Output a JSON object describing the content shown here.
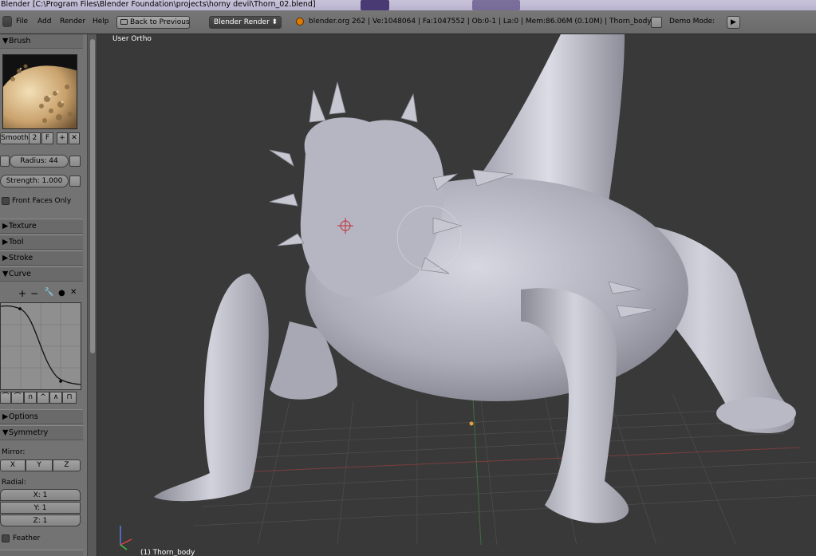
{
  "window": {
    "title": "Blender [C:\\Program Files\\Blender Foundation\\projects\\horny devil\\Thorn_02.blend]"
  },
  "menu": {
    "items": [
      "File",
      "Add",
      "Render",
      "Help"
    ],
    "back_button": "Back to Previous",
    "render_engine": "Blender Render",
    "info": "blender.org 262 | Ve:1048064 | Fa:1047552 | Ob:0-1 | La:0 | Mem:86.06M (0.10M) | Thorn_body",
    "demo_mode_label": "Demo Mode:"
  },
  "brush": {
    "header": "Brush",
    "name": "Smooth",
    "users": "2",
    "fake_user": "F",
    "radius": "Radius: 44",
    "strength": "Strength: 1.000",
    "front_faces_only": "Front Faces Only"
  },
  "sections": {
    "texture": "Texture",
    "tool": "Tool",
    "stroke": "Stroke",
    "curve": "Curve",
    "options": "Options",
    "symmetry": "Symmetry"
  },
  "symmetry": {
    "mirror_label": "Mirror:",
    "mirror_axes": [
      "X",
      "Y",
      "Z"
    ],
    "radial_label": "Radial:",
    "radial_x": "X: 1",
    "radial_y": "Y: 1",
    "radial_z": "Z: 1",
    "feather": "Feather"
  },
  "viewport": {
    "view_label": "User Ortho",
    "object_label": "(1) Thorn_body"
  },
  "colors": {
    "viewport_bg": "#393939",
    "panel_bg": "#737373",
    "model": "#bdbdc9"
  }
}
